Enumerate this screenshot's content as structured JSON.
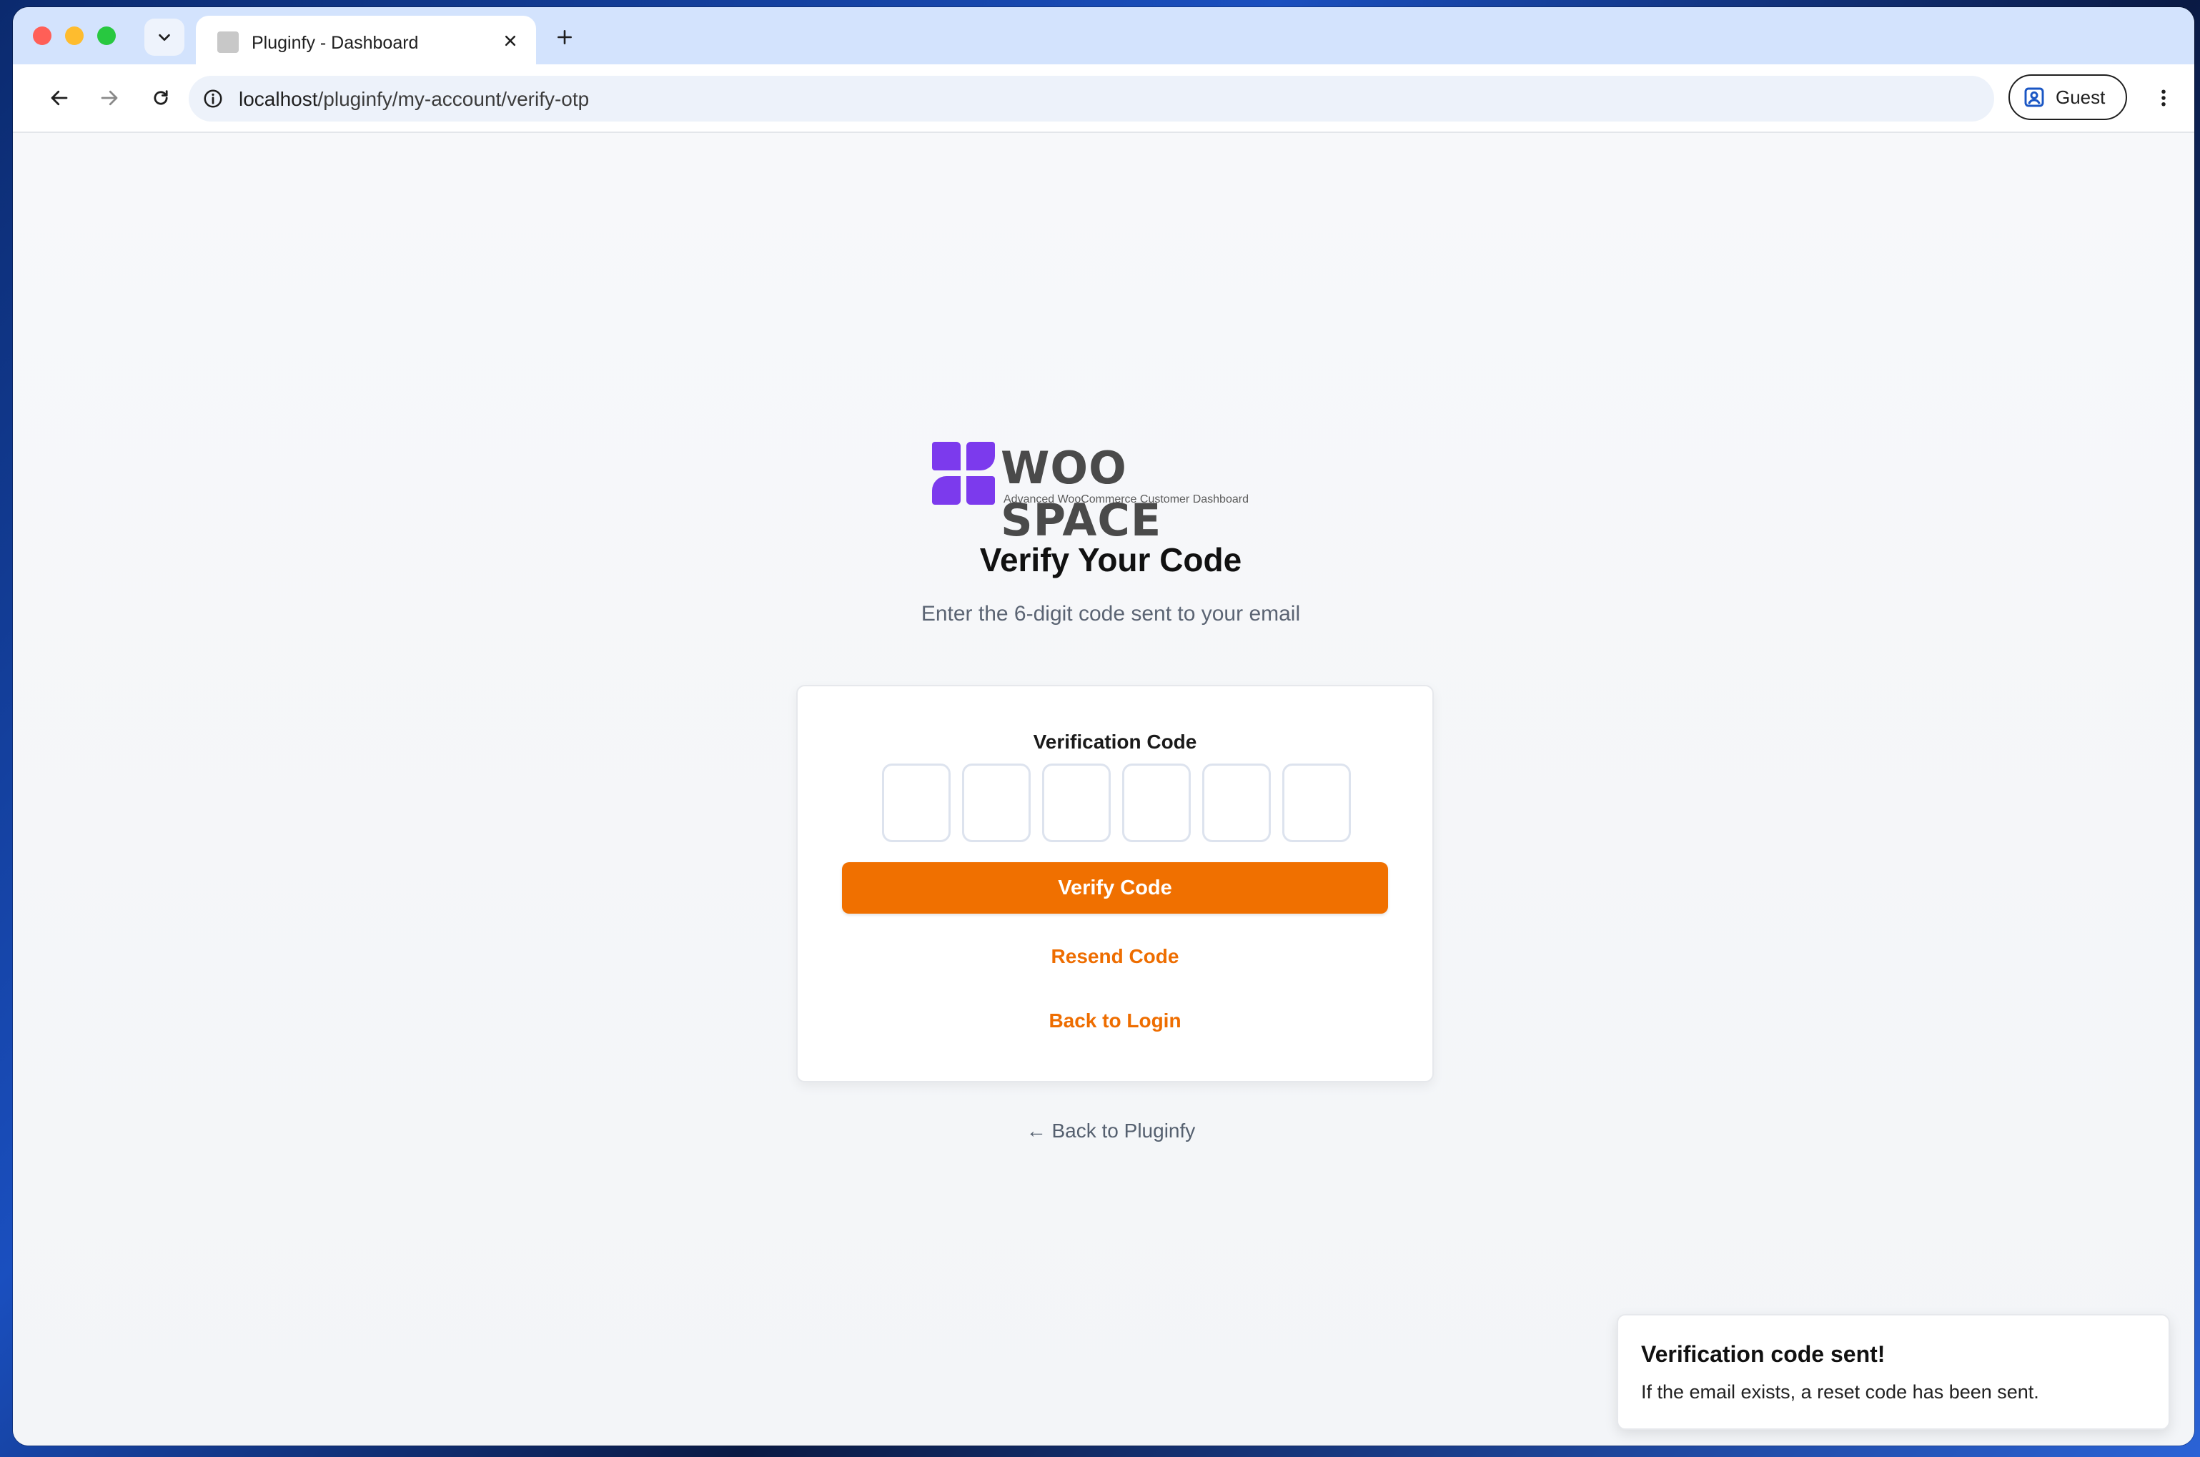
{
  "browser": {
    "tab": {
      "title": "Pluginfy - Dashboard"
    },
    "address": {
      "host": "localhost",
      "path": "/pluginfy/my-account/verify-otp"
    },
    "profile": {
      "label": "Guest"
    }
  },
  "brand": {
    "name": "WOO SPACE",
    "tagline": "Advanced WooCommerce Customer Dashboard",
    "accent": "#7c3aed"
  },
  "page": {
    "heading": "Verify Your Code",
    "subheading": "Enter the 6-digit code sent to your email"
  },
  "form": {
    "code_label": "Verification Code",
    "digits": [
      "",
      "",
      "",
      "",
      "",
      ""
    ],
    "verify_label": "Verify Code",
    "resend_label": "Resend Code",
    "back_login_label": "Back to Login",
    "button_color": "#f07000"
  },
  "footer": {
    "back_link": "← Back to Pluginfy"
  },
  "toast": {
    "title": "Verification code sent!",
    "message": "If the email exists, a reset code has been sent."
  }
}
